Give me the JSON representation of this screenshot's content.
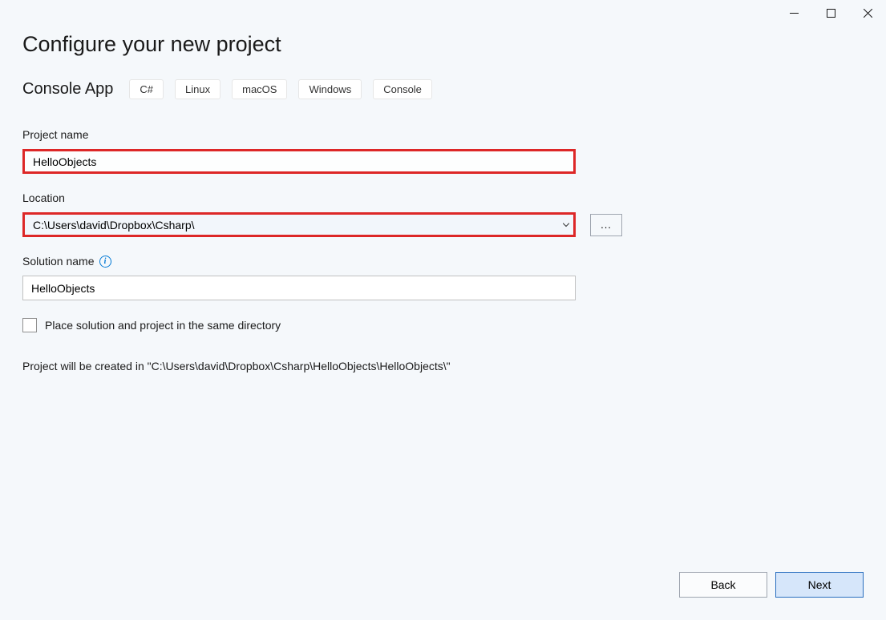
{
  "title": "Configure your new project",
  "subtitle": "Console App",
  "tags": [
    "C#",
    "Linux",
    "macOS",
    "Windows",
    "Console"
  ],
  "fields": {
    "projectName": {
      "label": "Project name",
      "value": "HelloObjects"
    },
    "location": {
      "label": "Location",
      "value": "C:\\Users\\david\\Dropbox\\Csharp\\",
      "browse": "..."
    },
    "solutionName": {
      "label": "Solution name",
      "value": "HelloObjects"
    }
  },
  "checkbox": {
    "label": "Place solution and project in the same directory",
    "checked": false
  },
  "summary": "Project will be created in \"C:\\Users\\david\\Dropbox\\Csharp\\HelloObjects\\HelloObjects\\\"",
  "buttons": {
    "back": "Back",
    "next": "Next"
  }
}
